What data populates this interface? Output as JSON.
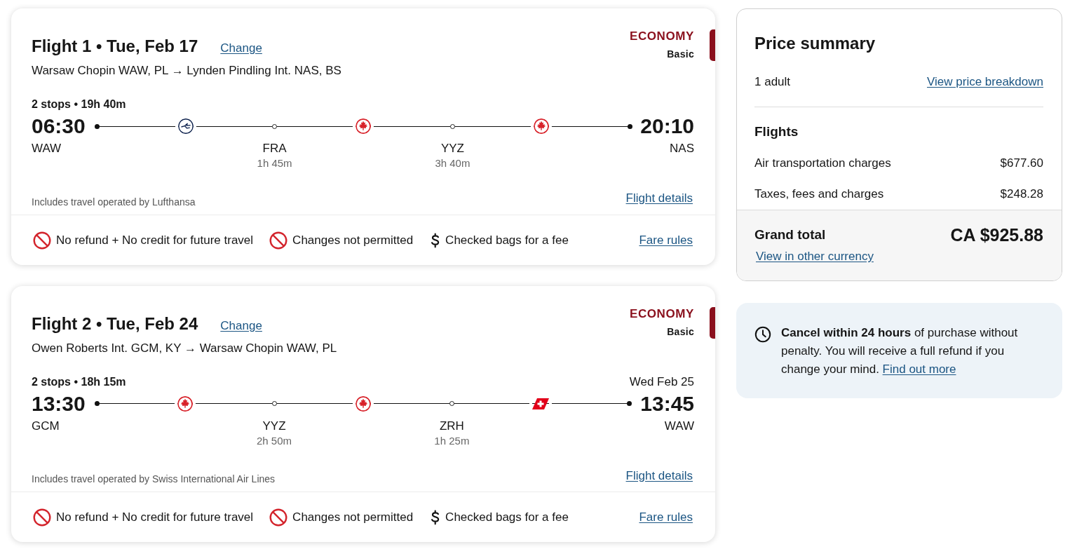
{
  "flights": [
    {
      "title": "Flight 1 • Tue, Feb 17",
      "change_link": "Change",
      "route": "Warsaw Chopin WAW, PL → Lynden Pindling Int. NAS, BS",
      "cabin": "ECONOMY",
      "fare": "Basic",
      "summary": "2 stops • 19h 40m",
      "departure": {
        "time": "06:30",
        "airport": "WAW"
      },
      "arrival": {
        "time": "20:10",
        "airport": "NAS"
      },
      "timeline": [
        {
          "kind": "bird"
        },
        {
          "kind": "stop",
          "airport": "FRA",
          "layover": "1h 45m"
        },
        {
          "kind": "leaf"
        },
        {
          "kind": "stop",
          "airport": "YYZ",
          "layover": "3h 40m"
        },
        {
          "kind": "leaf"
        }
      ],
      "operated_by": "Includes travel operated by Lufthansa",
      "details_link": "Flight details",
      "conditions": [
        {
          "kind": "prohibited",
          "text": "No refund + No credit for future travel"
        },
        {
          "kind": "prohibited",
          "text": "Changes not permitted"
        },
        {
          "kind": "fee",
          "text": "Checked bags for a fee"
        }
      ],
      "rules_link": "Fare rules"
    },
    {
      "title": "Flight 2 • Tue, Feb 24",
      "change_link": "Change",
      "route": "Owen Roberts Int. GCM, KY → Warsaw Chopin WAW, PL",
      "cabin": "ECONOMY",
      "fare": "Basic",
      "summary": "2 stops • 18h 15m",
      "departure": {
        "time": "13:30",
        "airport": "GCM"
      },
      "arrival": {
        "date": "Wed Feb 25",
        "time": "13:45",
        "airport": "WAW"
      },
      "timeline": [
        {
          "kind": "leaf"
        },
        {
          "kind": "stop",
          "airport": "YYZ",
          "layover": "2h 50m"
        },
        {
          "kind": "leaf"
        },
        {
          "kind": "stop",
          "airport": "ZRH",
          "layover": "1h 25m"
        },
        {
          "kind": "tail"
        }
      ],
      "operated_by": "Includes travel operated by Swiss International Air Lines",
      "details_link": "Flight details",
      "conditions": [
        {
          "kind": "prohibited",
          "text": "No refund + No credit for future travel"
        },
        {
          "kind": "prohibited",
          "text": "Changes not permitted"
        },
        {
          "kind": "fee",
          "text": "Checked bags for a fee"
        }
      ],
      "rules_link": "Fare rules"
    }
  ],
  "price_summary": {
    "title": "Price summary",
    "passengers": "1 adult",
    "breakdown_link": "View price breakdown",
    "section_title": "Flights",
    "lines": [
      {
        "label": "Air transportation charges",
        "amount": "$677.60"
      },
      {
        "label": "Taxes, fees and charges",
        "amount": "$248.28"
      }
    ],
    "total_label": "Grand total",
    "total": "CA $925.88",
    "currency_link": "View in other currency"
  },
  "notice": {
    "text": "**Cancel within 24 hours** of purchase without penalty. You will receive a full refund if you change your mind.",
    "link": "Find out more"
  }
}
